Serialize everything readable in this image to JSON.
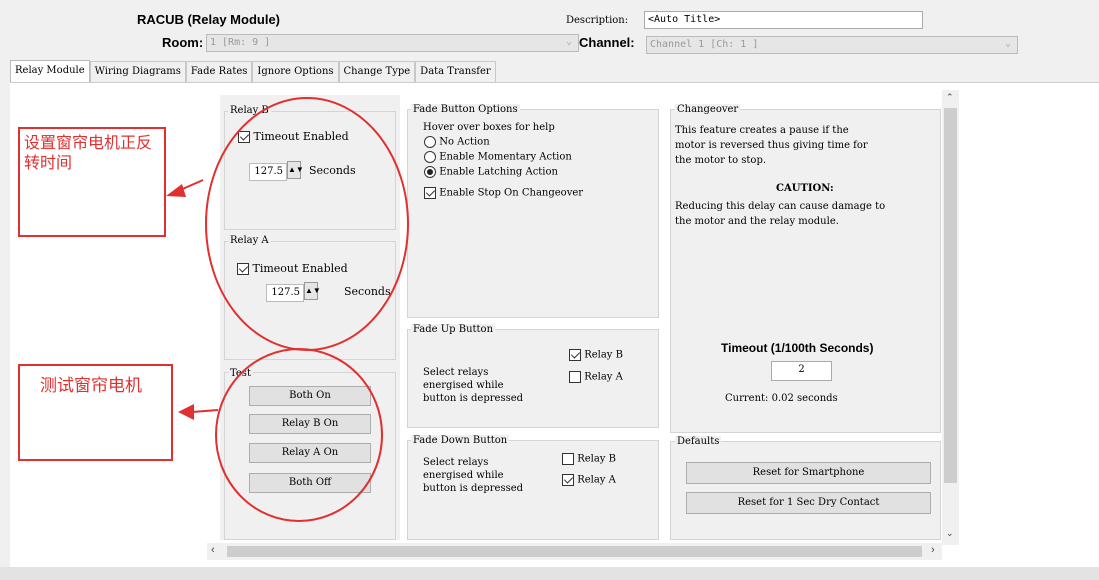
{
  "header": {
    "title": "RACUB (Relay Module)",
    "description_label": "Description:",
    "description_value": "<Auto Title>",
    "room_label": "Room:",
    "room_value": "1 [Rm: 9 ]",
    "channel_label": "Channel:",
    "channel_value": "Channel 1 [Ch: 1 ]"
  },
  "tabs": [
    "Relay Module",
    "Wiring Diagrams",
    "Fade Rates",
    "Ignore Options",
    "Change Type",
    "Data Transfer"
  ],
  "relay_b": {
    "title": "Relay B",
    "timeout_label": "Timeout Enabled",
    "timeout_checked": true,
    "value": "127.5",
    "unit": "Seconds"
  },
  "relay_a": {
    "title": "Relay A",
    "timeout_label": "Timeout Enabled",
    "timeout_checked": true,
    "value": "127.5",
    "unit": "Seconds"
  },
  "test": {
    "title": "Test",
    "buttons": [
      "Both On",
      "Relay B On",
      "Relay A On",
      "Both Off"
    ]
  },
  "fade_button_options": {
    "title": "Fade Button Options",
    "hint": "Hover over boxes for help",
    "options": [
      "No Action",
      "Enable Momentary Action",
      "Enable Latching Action"
    ],
    "selected": "Enable Latching Action",
    "stop_on_changeover": "Enable Stop On Changeover"
  },
  "fade_up": {
    "title": "Fade Up Button",
    "text": [
      "Select relays",
      "energised while",
      "button is depressed"
    ],
    "relay_b": "Relay B",
    "relay_b_checked": true,
    "relay_a": "Relay A",
    "relay_a_checked": false
  },
  "fade_down": {
    "title": "Fade Down Button",
    "text": [
      "Select relays",
      "energised while",
      "button is depressed"
    ],
    "relay_b": "Relay B",
    "relay_b_checked": false,
    "relay_a": "Relay A",
    "relay_a_checked": true
  },
  "changeover": {
    "title": "Changeover",
    "text": [
      "This feature creates a pause if the",
      "motor is reversed thus giving time for",
      "the motor to stop."
    ],
    "caution_title": "CAUTION:",
    "caution_text": [
      "Reducing this delay can cause damage to",
      "the motor and the relay module."
    ],
    "timeout_label": "Timeout (1/100th Seconds)",
    "timeout_value": "2",
    "current": "Current: 0.02 seconds"
  },
  "defaults": {
    "title": "Defaults",
    "smartphone": "Reset for Smartphone",
    "dry_contact": "Reset for 1 Sec Dry Contact"
  },
  "annotations": {
    "relay_note": [
      "设置窗帘电机正反",
      "转时间"
    ],
    "test_note": "测试窗帘电机"
  },
  "colors": {
    "annotation_red": "#e03030"
  }
}
